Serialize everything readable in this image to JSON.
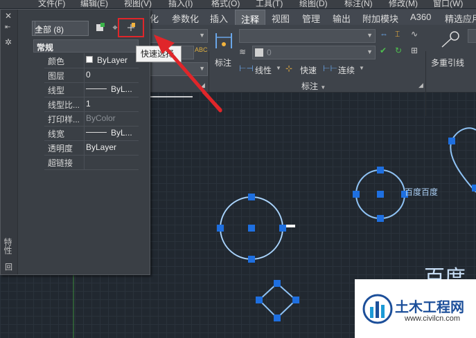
{
  "menubar": {
    "items": [
      "文件(F)",
      "编辑(E)",
      "视图(V)",
      "插入(I)",
      "格式(O)",
      "工具(T)",
      "绘图(D)",
      "标注(N)",
      "修改(M)",
      "窗口(W)"
    ]
  },
  "ribbon": {
    "tabs": [
      "化",
      "参数化",
      "插入",
      "注释",
      "视图",
      "管理",
      "输出",
      "附加模块",
      "A360",
      "精选应用"
    ],
    "active_tab": "注释",
    "dimension_panel": {
      "big_button": "标注",
      "linear_label": "线性",
      "quick_label": "快速",
      "continue_label": "连续",
      "title": "标注",
      "layer_value": "0"
    },
    "leader_panel": {
      "big_button": "多重引线"
    }
  },
  "palette": {
    "title_vertical": "特性",
    "filter_value": "全部 (8)",
    "section": "常规",
    "properties": [
      {
        "name": "颜色",
        "value": "ByLayer",
        "kind": "color"
      },
      {
        "name": "图层",
        "value": "0",
        "kind": "text"
      },
      {
        "name": "线型",
        "value": "ByL...",
        "kind": "linetype"
      },
      {
        "name": "线型比...",
        "value": "1",
        "kind": "text"
      },
      {
        "name": "打印样...",
        "value": "ByColor",
        "kind": "dim"
      },
      {
        "name": "线宽",
        "value": "ByL...",
        "kind": "linetype"
      },
      {
        "name": "透明度",
        "value": "ByLayer",
        "kind": "text"
      },
      {
        "name": "超链接",
        "value": "",
        "kind": "text"
      }
    ]
  },
  "tooltip": {
    "text": "快速选择"
  },
  "canvas": {
    "label_small": "百度百度",
    "label_large": "百度"
  },
  "watermark": {
    "title": "土木工程网",
    "url": "www.civilcn.com"
  },
  "colors": {
    "grip": "#1e6fe0",
    "highlight": "#e0262a",
    "arrow": "#e0262a",
    "entity": "#8fc3f5"
  }
}
